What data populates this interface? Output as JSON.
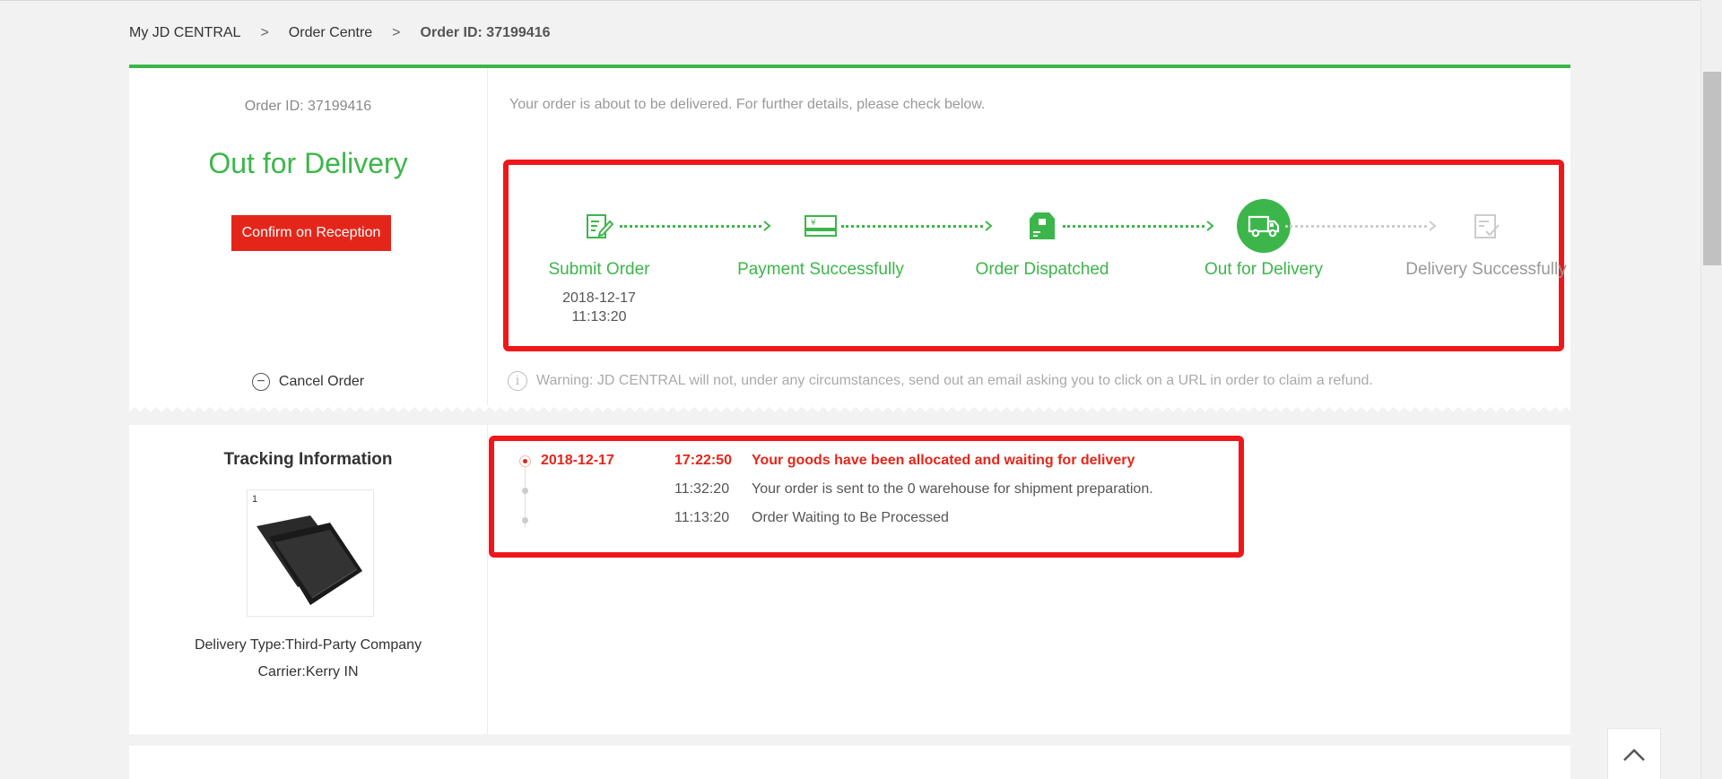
{
  "breadcrumb": {
    "home": "My JD CENTRAL",
    "sep": ">",
    "order_centre": "Order Centre",
    "current": "Order ID: 37199416"
  },
  "status": {
    "order_id": "Order ID: 37199416",
    "title": "Out for Delivery",
    "confirm_label": "Confirm on Reception",
    "cancel_label": "Cancel Order",
    "intro": "Your order is about to be delivered. For further details, please check below.",
    "warning": "Warning: JD CENTRAL will not, under any circumstances, send out an email asking you to click on a URL in order to claim a refund."
  },
  "progress": {
    "steps": [
      {
        "label": "Submit Order",
        "date": "2018-12-17",
        "time": "11:13:20",
        "icon": "edit-document-icon",
        "state": "done"
      },
      {
        "label": "Payment Successfully",
        "icon": "payment-card-icon",
        "state": "done"
      },
      {
        "label": "Order Dispatched",
        "icon": "package-box-icon",
        "state": "done"
      },
      {
        "label": "Out for Delivery",
        "icon": "delivery-truck-icon",
        "state": "current"
      },
      {
        "label": "Delivery Successfully",
        "icon": "checked-document-icon",
        "state": "pending"
      }
    ],
    "accent_color": "#3cb64a",
    "pending_color": "#cccccc"
  },
  "tracking": {
    "title": "Tracking Information",
    "delivery_type": "Delivery Type:Third-Party Company",
    "carrier": "Carrier:Kerry IN",
    "thumb_mark": "1",
    "events": [
      {
        "date": "2018-12-17",
        "time": "17:22:50",
        "text": "Your goods have been allocated and waiting for delivery"
      },
      {
        "date": "",
        "time": "11:32:20",
        "text": "Your order is sent to the 0 warehouse for shipment preparation."
      },
      {
        "date": "",
        "time": "11:13:20",
        "text": "Order Waiting to Be Processed"
      }
    ]
  },
  "colors": {
    "highlight_border": "#f0171a",
    "primary_red": "#e4261a",
    "green": "#3cb64a"
  }
}
